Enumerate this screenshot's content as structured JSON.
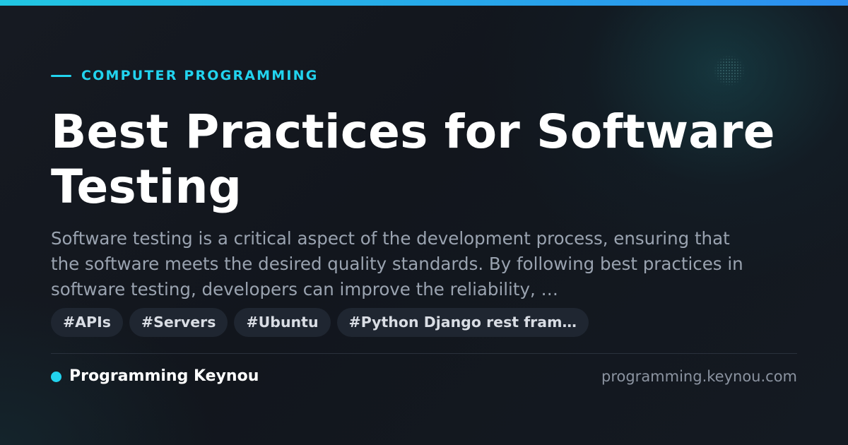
{
  "colors": {
    "accent": "#22d3ee",
    "accent_gradient_end": "#2c8ef0",
    "background": "#12161d",
    "title": "#ffffff",
    "excerpt": "#9aa3b0",
    "tag_background": "#1f2631",
    "tag_text": "#d9dde4",
    "url": "#8b93a0"
  },
  "header": {
    "category": "COMPUTER PROGRAMMING"
  },
  "article": {
    "title": "Best Practices for Software Testing",
    "excerpt": "Software testing is a critical aspect of the development process, ensuring that the software meets the desired quality standards. By following best practices in software testing, developers can improve the reliability, …"
  },
  "tags": [
    "#APIs",
    "#Servers",
    "#Ubuntu",
    "#Python Django rest fram…"
  ],
  "footer": {
    "brand": "Programming Keynou",
    "url": "programming.keynou.com"
  }
}
